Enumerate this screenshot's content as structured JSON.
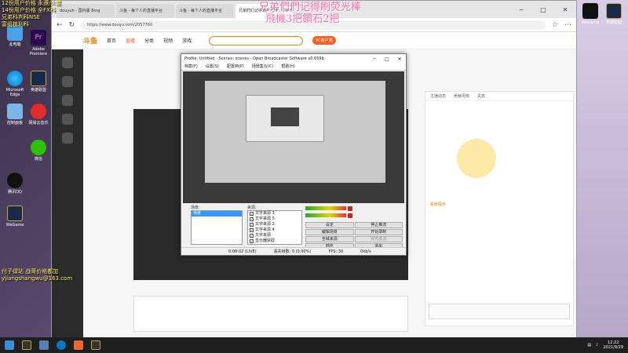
{
  "overlay": {
    "top_left_line1": "12份用户价格 永遵/火星",
    "top_left_line2": "14份用户价格 全FX科",
    "top_left_line3": "兄弟科判科NSE",
    "top_left_line4": "富组植利科",
    "center_line1": "兄弟們們记得刷荧光棒",
    "center_line2": "飛機3把鑽石2把",
    "bottom_left_line1": "付子绿站 战哥价格都加",
    "bottom_left_line2": "yjiangshangwu@163.com"
  },
  "desktop_icons": [
    {
      "label": "此电脑"
    },
    {
      "label": "Adobe Premiere"
    },
    {
      "label": "Microsoft Edge"
    },
    {
      "label": "英雄联盟"
    },
    {
      "label": "网易云音乐"
    },
    {
      "label": "控制面板"
    },
    {
      "label": "微信"
    },
    {
      "label": "腾讯QQ"
    },
    {
      "label": "WeGame"
    }
  ],
  "right_dock": {
    "item1": "WeGame",
    "item2": "英雄联盟"
  },
  "browser": {
    "tabs": [
      {
        "label": "douyuh - 国内版 Bing"
      },
      {
        "label": "斗鱼 - 每个人的直播平台"
      },
      {
        "label": "斗鱼 - 每个人的直播平台"
      },
      {
        "label": "兄弟們们记得刷荧光棒 - 炉石传说直播"
      }
    ],
    "url": "https://www.douyu.com/2057760",
    "site": {
      "logo": "斗鱼",
      "nav": [
        "首页",
        "直播",
        "分类",
        "视频",
        "游戏"
      ],
      "pc_button": "PC客户端",
      "side_tabs": [
        "主播动态",
        "贡献周榜",
        "贵宾"
      ],
      "chat_label": "系统提示"
    }
  },
  "obs": {
    "title": "Profile: Untitled - Scenes: scenes - Open Broadcaster Software v0.659b",
    "menu": [
      "档案(F)",
      "设置(S)",
      "配置档(P)",
      "场景集合(C)",
      "帮助(H)"
    ],
    "scenes_label": "场景:",
    "sources_label": "来源:",
    "scenes": [
      "场景"
    ],
    "sources": [
      "文字来源 3",
      "文字来源 5",
      "文字来源 2",
      "文字来源 4",
      "文字来源",
      "显示器获取"
    ],
    "buttons": {
      "settings": "设定",
      "stop_stream": "停止推流",
      "edit_scene": "编辑场景",
      "start_record": "开始录制",
      "global_sources": "全域来源",
      "preview": "预览串流",
      "plugins": "插件",
      "exit": "退出"
    },
    "status": {
      "time": "0:00:02 (LIVE)",
      "dropped_frames": "丢失帧数: 0 (0.00%)",
      "fps": "FPS: 30",
      "bitrate": "0kb/s"
    }
  },
  "taskbar": {
    "time": "12:22",
    "date": "2021/9/29"
  }
}
